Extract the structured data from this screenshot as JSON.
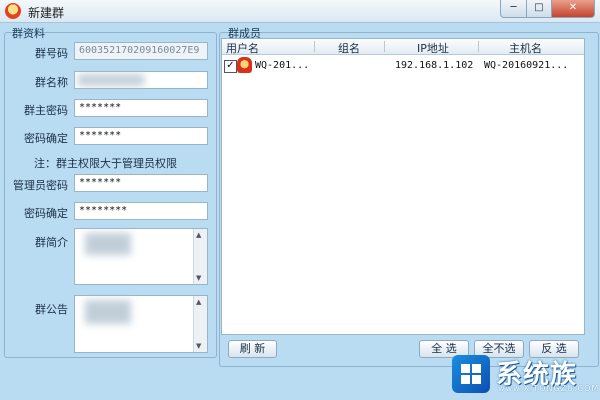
{
  "window": {
    "title": "新建群",
    "minimize": "─",
    "maximize": "□",
    "close": "✕"
  },
  "left_panel": {
    "legend": "群资料",
    "fields": {
      "group_id": {
        "label": "群号码",
        "value": "600352170209160027E9"
      },
      "group_name": {
        "label": "群名称",
        "value": ""
      },
      "owner_password": {
        "label": "群主密码",
        "value": "*******"
      },
      "owner_password_confirm": {
        "label": "密码确定",
        "value": "*******"
      },
      "admin_password": {
        "label": "管理员密码",
        "value": "*******"
      },
      "admin_password_confirm": {
        "label": "密码确定",
        "value": "********"
      },
      "intro": {
        "label": "群简介"
      },
      "notice": {
        "label": "群公告"
      }
    },
    "note": "注：群主权限大于管理员权限"
  },
  "right_panel": {
    "legend": "群成员",
    "columns": [
      "用户名",
      "组名",
      "IP地址",
      "主机名"
    ],
    "rows": [
      {
        "checked": true,
        "username": "WQ-201...",
        "group": "",
        "ip": "192.168.1.102",
        "host": "WQ-20160921..."
      }
    ],
    "buttons": {
      "refresh": "刷 新",
      "select_all": "全 选",
      "select_none": "全不选",
      "invert": "反 选"
    }
  },
  "watermark": {
    "brand": "系统族",
    "url": "www.XITONGZU.COM"
  },
  "colors": {
    "background": "#b9dcf3",
    "close_button": "#c5432c",
    "logo_blue": "#0d4fb0"
  }
}
